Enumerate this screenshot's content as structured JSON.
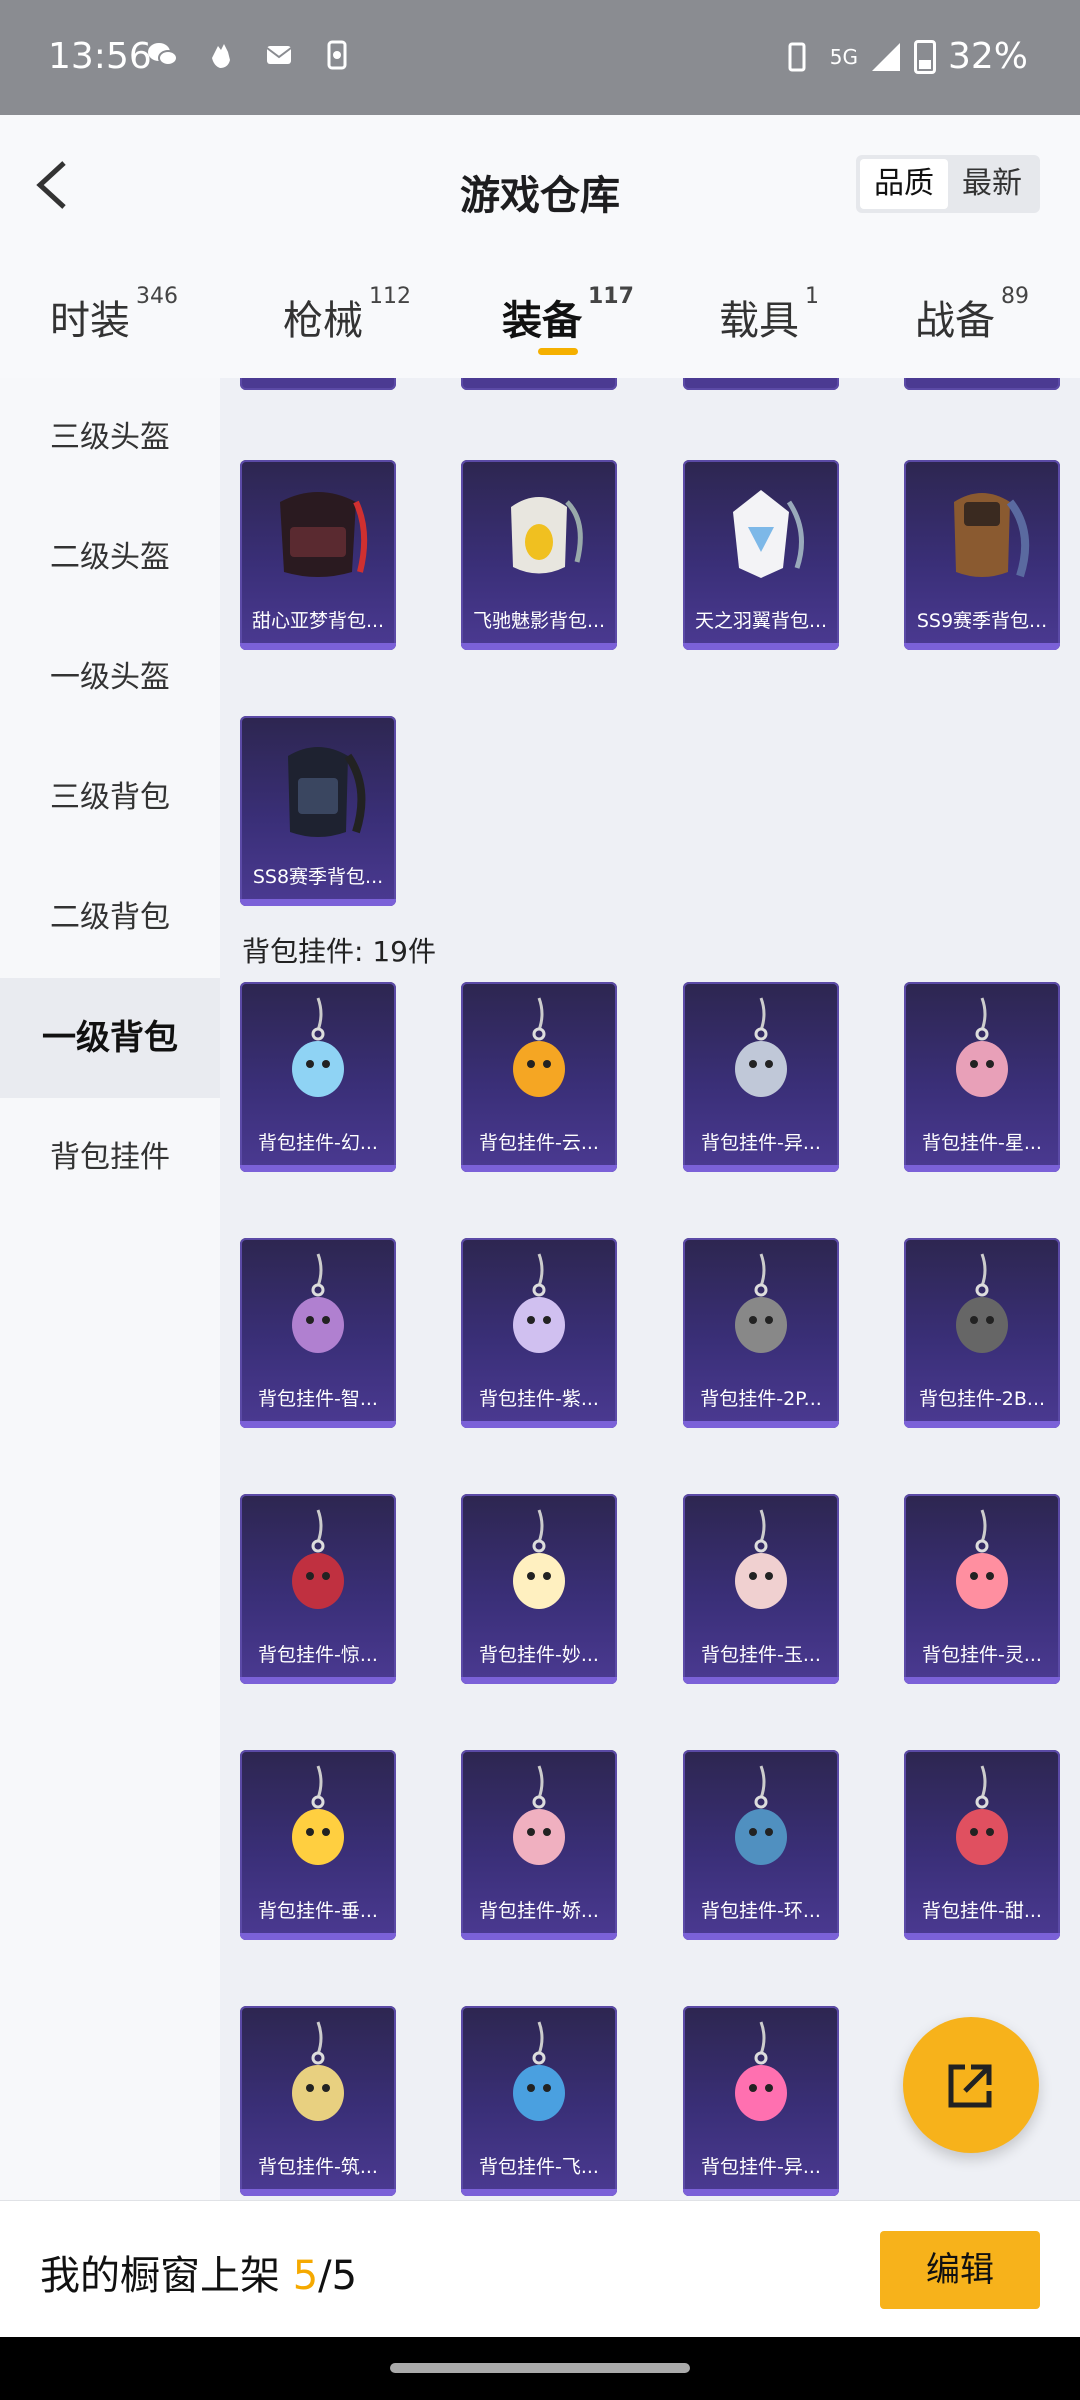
{
  "status_bar": {
    "time": "13:56",
    "network": "5G",
    "battery": "32%"
  },
  "header": {
    "title": "游戏仓库",
    "back_icon": "back-arrow-icon",
    "sort_options": [
      "品质",
      "最新"
    ],
    "active_sort": "品质"
  },
  "tabs": [
    {
      "label": "时装",
      "count": "346"
    },
    {
      "label": "枪械",
      "count": "112"
    },
    {
      "label": "装备",
      "count": "117",
      "active": true
    },
    {
      "label": "载具",
      "count": "1"
    },
    {
      "label": "战备",
      "count": "89"
    }
  ],
  "sidebar": {
    "items": [
      {
        "label": "三级头盔"
      },
      {
        "label": "二级头盔"
      },
      {
        "label": "一级头盔"
      },
      {
        "label": "三级背包"
      },
      {
        "label": "二级背包"
      },
      {
        "label": "一级背包",
        "active": true
      },
      {
        "label": "背包挂件"
      }
    ]
  },
  "backpacks": [
    {
      "label": "甜心亚梦背包..."
    },
    {
      "label": "飞驰魅影背包..."
    },
    {
      "label": "天之羽翼背包..."
    },
    {
      "label": "SS9赛季背包..."
    },
    {
      "label": "SS8赛季背包..."
    }
  ],
  "section": {
    "title": "背包挂件: 19件"
  },
  "pendants": [
    {
      "label": "背包挂件-幻..."
    },
    {
      "label": "背包挂件-云..."
    },
    {
      "label": "背包挂件-异..."
    },
    {
      "label": "背包挂件-星..."
    },
    {
      "label": "背包挂件-智..."
    },
    {
      "label": "背包挂件-紫..."
    },
    {
      "label": "背包挂件-2P..."
    },
    {
      "label": "背包挂件-2B..."
    },
    {
      "label": "背包挂件-惊..."
    },
    {
      "label": "背包挂件-妙..."
    },
    {
      "label": "背包挂件-玉..."
    },
    {
      "label": "背包挂件-灵..."
    },
    {
      "label": "背包挂件-垂..."
    },
    {
      "label": "背包挂件-娇..."
    },
    {
      "label": "背包挂件-环..."
    },
    {
      "label": "背包挂件-甜..."
    },
    {
      "label": "背包挂件-筑..."
    },
    {
      "label": "背包挂件-飞..."
    },
    {
      "label": "背包挂件-异..."
    }
  ],
  "bottom_bar": {
    "showcase_label": "我的橱窗上架",
    "showcase_current": "5",
    "showcase_total": "/5",
    "edit_label": "编辑"
  },
  "fab": {
    "icon": "share-external-icon"
  },
  "colors": {
    "accent": "#f7b21b",
    "card_bg": "#3a2f78",
    "card_strip": "#7b61d8"
  }
}
